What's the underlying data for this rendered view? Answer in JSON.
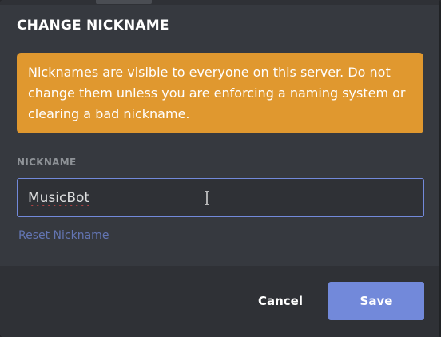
{
  "modal": {
    "title": "CHANGE NICKNAME"
  },
  "warning": {
    "text": "Nicknames are visible to everyone on this server. Do not change them unless you are enforcing a naming system or clearing a bad nickname."
  },
  "nickname_field": {
    "label": "NICKNAME",
    "value": "MusicBot"
  },
  "reset_link": {
    "label": "Reset Nickname"
  },
  "footer": {
    "cancel_label": "Cancel",
    "save_label": "Save"
  },
  "colors": {
    "modal_background": "#36393f",
    "footer_background": "#2f3136",
    "warning_background": "#e0982f",
    "accent": "#7289da",
    "label_gray": "#8e9297",
    "input_text": "#dcddde"
  },
  "icons": {
    "cursor": "text-cursor-icon"
  }
}
